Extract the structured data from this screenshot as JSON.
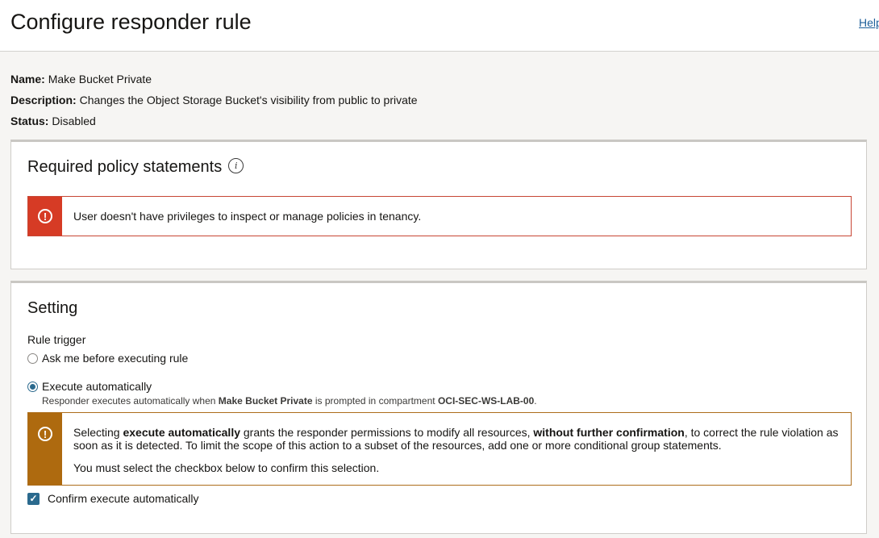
{
  "header": {
    "title": "Configure responder rule",
    "help": "Help"
  },
  "meta": {
    "name_label": "Name:",
    "name_value": "Make Bucket Private",
    "description_label": "Description:",
    "description_value": "Changes the Object Storage Bucket's visibility from public to private",
    "status_label": "Status:",
    "status_value": "Disabled"
  },
  "policy": {
    "title": "Required policy statements",
    "error_message": "User doesn't have privileges to inspect or manage policies in tenancy."
  },
  "setting": {
    "title": "Setting",
    "rule_trigger_label": "Rule trigger",
    "options": [
      {
        "label": "Ask me before executing rule",
        "checked": false
      },
      {
        "label": "Execute automatically",
        "checked": true
      }
    ],
    "auto_help": {
      "prefix": "Responder executes automatically when ",
      "rule": "Make Bucket Private",
      "middle": " is prompted in compartment ",
      "compartment": "OCI-SEC-WS-LAB-00",
      "suffix": "."
    },
    "warning": {
      "p1_a": "Selecting ",
      "p1_b": "execute automatically",
      "p1_c": " grants the responder permissions to modify all resources, ",
      "p1_d": "without further confirmation",
      "p1_e": ", to correct the rule violation as soon as it is detected. To limit the scope of this action to a subset of the resources, add one or more conditional group statements.",
      "p2": "You must select the checkbox below to confirm this selection."
    },
    "confirm_label": "Confirm execute automatically",
    "confirm_checked": true
  }
}
